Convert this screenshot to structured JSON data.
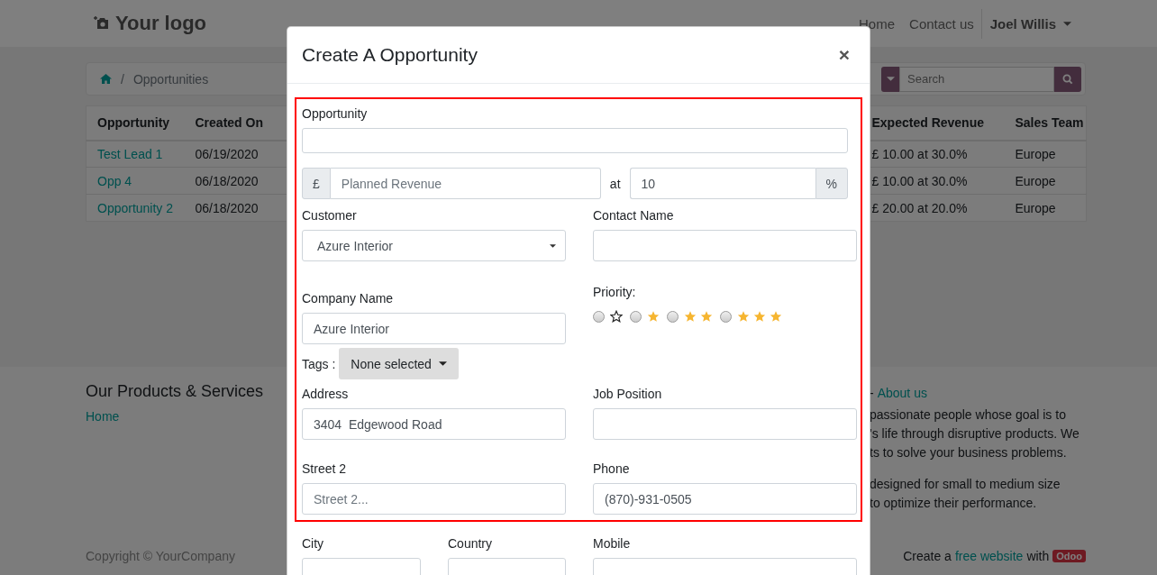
{
  "header": {
    "logo": "Your logo",
    "nav": [
      "Home",
      "Contact us"
    ],
    "user": "Joel Willis"
  },
  "breadcrumb": {
    "current": "Opportunities",
    "separator": "/"
  },
  "search": {
    "placeholder": "Search"
  },
  "table": {
    "columns": [
      "Opportunity",
      "Created On",
      "Expected Revenue",
      "Sales Team"
    ],
    "rows": [
      {
        "opportunity": "Test Lead 1",
        "created_on": "06/19/2020",
        "expected_revenue": "£ 10.00 at 30.0%",
        "sales_team": "Europe"
      },
      {
        "opportunity": "Opp 4",
        "created_on": "06/18/2020",
        "expected_revenue": "£ 10.00 at 30.0%",
        "sales_team": "Europe"
      },
      {
        "opportunity": "Opportunity 2",
        "created_on": "06/18/2020",
        "expected_revenue": "£ 20.00 at 20.0%",
        "sales_team": "Europe"
      }
    ]
  },
  "footer": {
    "title": "Our Products & Services",
    "links": [
      "Home"
    ],
    "about_prefix": "-",
    "about_link": "About us",
    "paragraphs": [
      [
        "passionate people whose goal is to",
        "'s life through disruptive products. We",
        "ts to solve your business problems."
      ],
      [
        "designed for small to medium size",
        "to optimize their performance."
      ]
    ],
    "copyright": "Copyright © YourCompany",
    "credit_prefix": "Create a",
    "credit_link": "free website",
    "credit_middle": "with",
    "credit_badge": "Odoo"
  },
  "modal": {
    "title": "Create A Opportunity",
    "close": "×",
    "opportunity": {
      "label": "Opportunity"
    },
    "revenue": {
      "currency": "£",
      "placeholder": "Planned Revenue",
      "at": "at",
      "probability": "10",
      "percent": "%"
    },
    "customer": {
      "label": "Customer",
      "value": "Azure Interior"
    },
    "contact_name": {
      "label": "Contact Name"
    },
    "company_name": {
      "label": "Company Name",
      "value": "Azure Interior"
    },
    "priority": {
      "label": "Priority:",
      "options": [
        {
          "selected": false,
          "icons": [
            {
              "kind": "empty"
            }
          ]
        },
        {
          "selected": false,
          "icons": [
            {
              "kind": "filled"
            }
          ]
        },
        {
          "selected": false,
          "icons": [
            {
              "kind": "filled"
            },
            {
              "kind": "filled"
            }
          ]
        },
        {
          "selected": false,
          "icons": [
            {
              "kind": "filled"
            },
            {
              "kind": "filled"
            },
            {
              "kind": "filled"
            }
          ]
        }
      ]
    },
    "tags": {
      "label": "Tags :",
      "button": "None selected"
    },
    "address": {
      "label": "Address",
      "value": "3404  Edgewood Road"
    },
    "job_position": {
      "label": "Job Position"
    },
    "street2": {
      "label": "Street 2",
      "placeholder": "Street 2..."
    },
    "phone": {
      "label": "Phone",
      "value": "(870)-931-0505"
    },
    "bottom": [
      {
        "label": "City"
      },
      {
        "label": "Country"
      },
      {
        "label": "Mobile"
      }
    ]
  }
}
